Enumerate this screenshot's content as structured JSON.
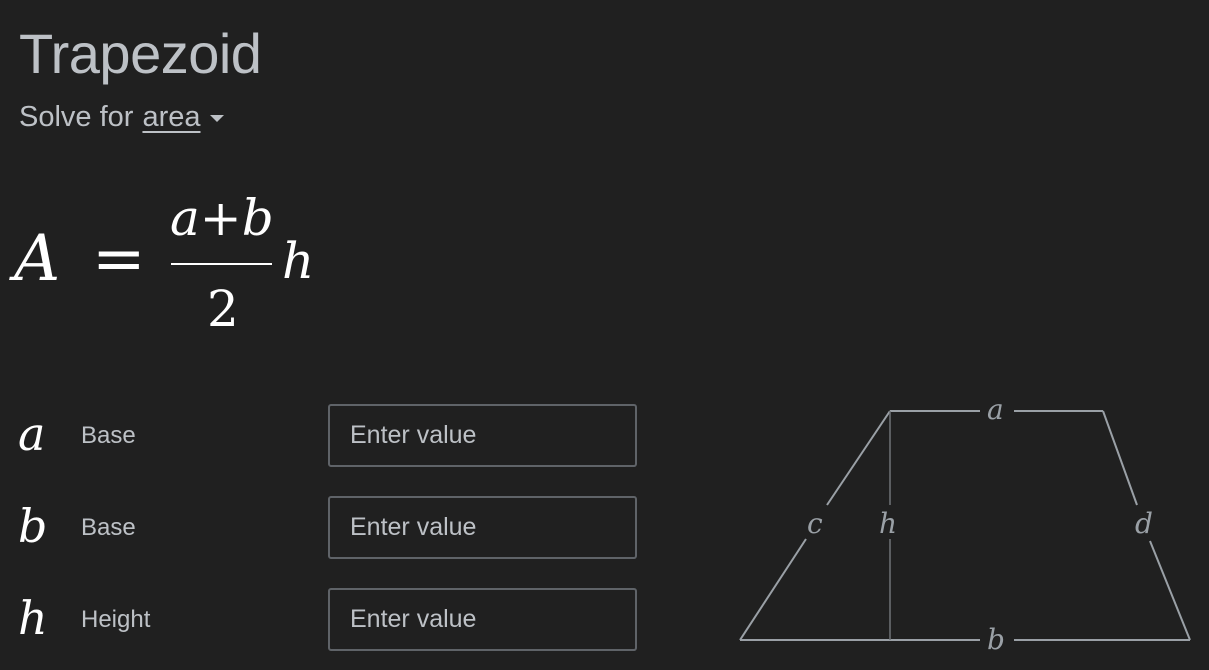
{
  "title": "Trapezoid",
  "solve": {
    "prefix": "Solve for",
    "selected": "area"
  },
  "formula": {
    "lhs": "A",
    "eq": "=",
    "numerator": "a+b",
    "denominator": "2",
    "factor": "h"
  },
  "inputs": [
    {
      "symbol": "a",
      "label": "Base",
      "placeholder": "Enter value"
    },
    {
      "symbol": "b",
      "label": "Base",
      "placeholder": "Enter value"
    },
    {
      "symbol": "h",
      "label": "Height",
      "placeholder": "Enter value"
    }
  ],
  "diagram": {
    "top": "a",
    "bottom": "b",
    "left": "c",
    "right": "d",
    "height": "h"
  }
}
